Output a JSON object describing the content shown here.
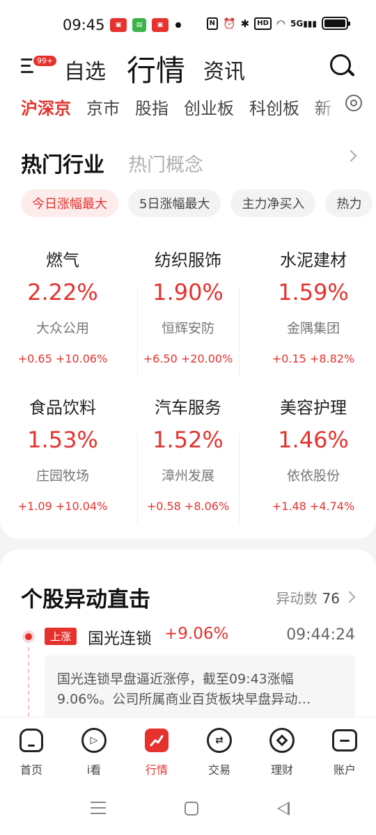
{
  "status_bar": {
    "time": "09:45",
    "network": "5G"
  },
  "header": {
    "badge": "99+",
    "tabs": [
      "自选",
      "行情",
      "资讯"
    ],
    "subtabs": [
      "沪深京",
      "京市",
      "股指",
      "创业板",
      "科创板",
      "新"
    ]
  },
  "hot": {
    "title": "热门行业",
    "title2": "热门概念",
    "filters": [
      "今日涨幅最大",
      "5日涨幅最大",
      "主力净买入",
      "热力"
    ],
    "items": [
      {
        "name": "燃气",
        "pct": "2.22%",
        "stock": "大众公用",
        "chg": "+0.65 +10.06%"
      },
      {
        "name": "纺织服饰",
        "pct": "1.90%",
        "stock": "恒辉安防",
        "chg": "+6.50 +20.00%"
      },
      {
        "name": "水泥建材",
        "pct": "1.59%",
        "stock": "金隅集团",
        "chg": "+0.15 +8.82%"
      },
      {
        "name": "食品饮料",
        "pct": "1.53%",
        "stock": "庄园牧场",
        "chg": "+1.09 +10.04%"
      },
      {
        "name": "汽车服务",
        "pct": "1.52%",
        "stock": "漳州发展",
        "chg": "+0.58 +8.06%"
      },
      {
        "name": "美容护理",
        "pct": "1.46%",
        "stock": "依依股份",
        "chg": "+1.48 +4.74%"
      }
    ]
  },
  "movers": {
    "title": "个股异动直击",
    "count_label": "异动数",
    "count": "76",
    "event": {
      "tag": "上涨",
      "stock": "国光连锁",
      "pct": "+9.06%",
      "time": "09:44:24",
      "desc_line1": "国光连锁早盘逼近涨停，截至09:43涨幅",
      "desc_line2": "9.06%。公司所属商业百货板块早盘异动…"
    }
  },
  "bottom_nav": [
    "首页",
    "i看",
    "行情",
    "交易",
    "理财",
    "账户"
  ],
  "colors": {
    "accent": "#e5322d"
  }
}
